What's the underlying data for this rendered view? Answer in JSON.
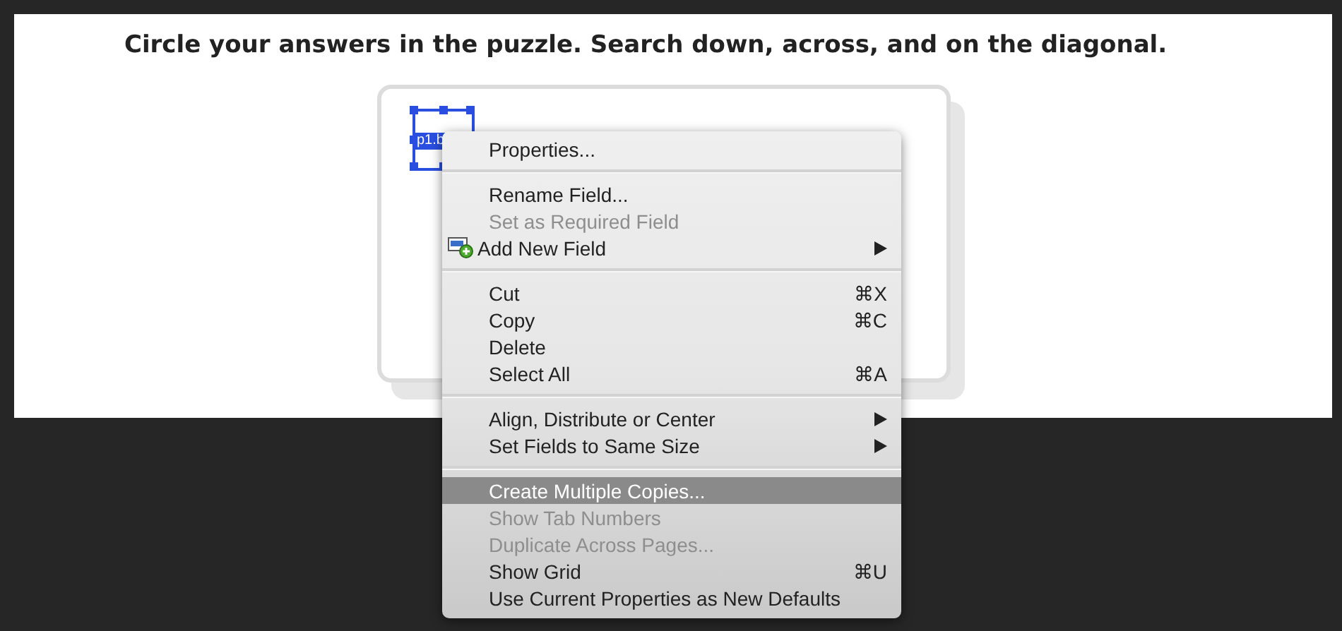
{
  "instructions": "Circle your answers in the puzzle. Search down, across, and on the diagonal.",
  "puzzle": {
    "field": {
      "label": "p1.b",
      "selected": true
    }
  },
  "context_menu": {
    "items": [
      {
        "kind": "item",
        "label": "Properties...",
        "disabled": false,
        "selected": false
      },
      {
        "kind": "separator"
      },
      {
        "kind": "item",
        "label": "Rename Field...",
        "disabled": false,
        "selected": false
      },
      {
        "kind": "item",
        "label": "Set as Required Field",
        "disabled": true,
        "selected": false
      },
      {
        "kind": "icon-item",
        "label": "Add New Field",
        "disabled": false,
        "selected": false,
        "submenu": true
      },
      {
        "kind": "separator"
      },
      {
        "kind": "item",
        "label": "Cut",
        "shortcut": "⌘X",
        "disabled": false,
        "selected": false
      },
      {
        "kind": "item",
        "label": "Copy",
        "shortcut": "⌘C",
        "disabled": false,
        "selected": false
      },
      {
        "kind": "item",
        "label": "Delete",
        "disabled": false,
        "selected": false
      },
      {
        "kind": "item",
        "label": "Select All",
        "shortcut": "⌘A",
        "disabled": false,
        "selected": false
      },
      {
        "kind": "separator"
      },
      {
        "kind": "item",
        "label": "Align, Distribute or Center",
        "disabled": false,
        "selected": false,
        "submenu": true
      },
      {
        "kind": "item",
        "label": "Set Fields to Same Size",
        "disabled": false,
        "selected": false,
        "submenu": true
      },
      {
        "kind": "separator"
      },
      {
        "kind": "item",
        "label": "Create Multiple Copies...",
        "disabled": false,
        "selected": true
      },
      {
        "kind": "item",
        "label": "Show Tab Numbers",
        "disabled": true,
        "selected": false
      },
      {
        "kind": "item",
        "label": "Duplicate Across Pages...",
        "disabled": true,
        "selected": false
      },
      {
        "kind": "item",
        "label": "Show Grid",
        "shortcut": "⌘U",
        "disabled": false,
        "selected": false
      },
      {
        "kind": "item",
        "label": "Use Current Properties as New Defaults",
        "disabled": false,
        "selected": false
      }
    ]
  }
}
